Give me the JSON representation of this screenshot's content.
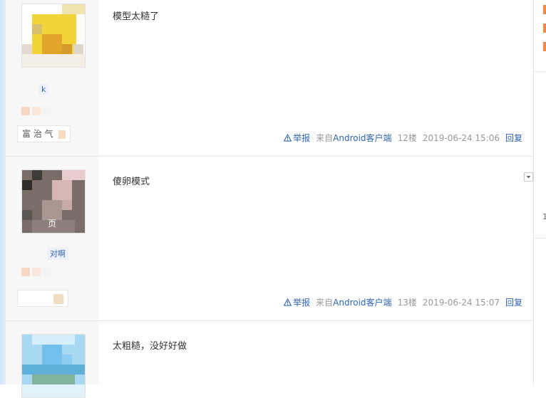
{
  "posts": [
    {
      "content": "模型太糙了",
      "username": "k",
      "level_text": "富    治 气",
      "report_label": "举报",
      "source_prefix": "来自",
      "source_brand": "Android客户端",
      "floor": "12楼",
      "time": "2019-06-24 15:06",
      "reply_label": "回复"
    },
    {
      "content": "傻卵模式",
      "username": "对啊",
      "avatar_caption": "页",
      "level_text": "",
      "report_label": "举报",
      "source_prefix": "来自",
      "source_brand": "Android客户端",
      "floor": "13楼",
      "time": "2019-06-24 15:07",
      "reply_label": "回复"
    },
    {
      "content": "太粗糙，没好好做"
    }
  ],
  "right_rail": {
    "label": "1"
  },
  "colors": {
    "link": "#2d64b3",
    "meta": "#999999",
    "accent": "#f08a4a",
    "divider": "#e5e5e5"
  },
  "icons": {
    "report": "warning-triangle-icon",
    "dropdown": "chevron-down-icon"
  }
}
